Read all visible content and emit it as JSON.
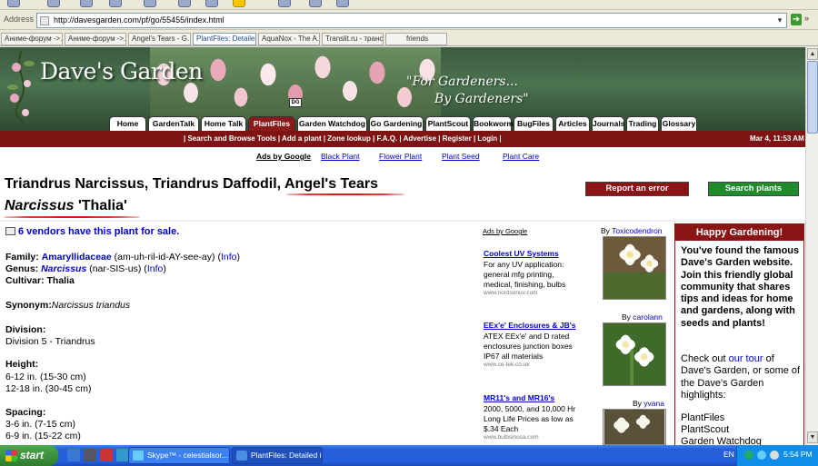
{
  "browser": {
    "address_label": "Address",
    "url": "http://davesgarden.com/pf/go/55455/index.html",
    "tabs": [
      {
        "label": "Аниме-форум ->..."
      },
      {
        "label": "Аниме-форум ->..."
      },
      {
        "label": "Angel's Tears - G..."
      },
      {
        "label": "PlantFiles: Detailed"
      },
      {
        "label": "AquaNox - The A..."
      },
      {
        "label": "Translit.ru - трансл"
      },
      {
        "label": "friends"
      }
    ]
  },
  "site": {
    "logo": "Dave's Garden",
    "slogan_line1": "\"For Gardeners...",
    "slogan_line2": "By Gardeners\"",
    "badge": "DG",
    "nav": [
      "Home",
      "GardenTalk",
      "Home Talk",
      "PlantFiles",
      "Garden Watchdog",
      "Go Gardening",
      "PlantScout",
      "Bookworm",
      "BugFiles",
      "Articles",
      "Journals",
      "Trading",
      "Glossary"
    ],
    "subnav": "| Search and Browse Tools | Add a plant | Zone lookup | F.A.Q. | Advertise | Register | Login |",
    "datetime": "Mar 4, 11:53 AM",
    "ads_by_google": "Ads by Google",
    "ad_links": [
      "Black Plant",
      "Flower Plant",
      "Plant Seed",
      "Plant Care"
    ]
  },
  "plant": {
    "title_prefix": "Triandrus Narcissus, Triandrus Daffodil, ",
    "title_highlight": "Angel's Tears",
    "latin_genus": "Narcissus",
    "cultivar_name": " 'Thalia'",
    "report_button": "Report an error",
    "search_button": "Search plants",
    "vendors": "6 vendors have this plant for sale.",
    "family_label": "Family:",
    "family": "Amaryllidaceae",
    "family_pron": " (am-uh-ril-id-AY-see-ay) (",
    "genus_label": "Genus:",
    "genus": "Narcissus",
    "genus_pron": " (nar-SIS-us) (",
    "info": "Info",
    "close_paren": ")",
    "cultivar_label": "Cultivar:",
    "cultivar": " Thalia",
    "synonym_label": "Synonym:",
    "synonym": "Narcissus triandus",
    "division_label": "Division:",
    "division": "Division 5 - Triandrus",
    "height_label": "Height:",
    "heights": [
      "6-12 in. (15-30 cm)",
      "12-18 in. (30-45 cm)"
    ],
    "spacing_label": "Spacing:",
    "spacings": [
      "3-6 in. (7-15 cm)",
      "6-9 in. (15-22 cm)"
    ]
  },
  "ads": {
    "header": "Ads by Google",
    "items": [
      {
        "title": "Coolest UV Systems",
        "lines": [
          "For any UV application:",
          "general mfg printing,",
          "medical, finishing, bulbs"
        ],
        "url": "www.nordsonuv.com"
      },
      {
        "title": "EEx'e' Enclosures & JB's",
        "lines": [
          "ATEX EEx'e' and D rated",
          "enclosures junction boxes",
          "IP67 all materials"
        ],
        "url": "www.ce-tek.co.uk"
      },
      {
        "title": "MR11's and MR16's",
        "lines": [
          "2000, 5000, and 10,000 Hr",
          "Long Life Prices as low as",
          "$.34 Each"
        ],
        "url": "www.bulbsinusa.com"
      }
    ]
  },
  "photos": [
    {
      "by": "By ",
      "user": "Toxicodendron"
    },
    {
      "by": "By ",
      "user": "carolann"
    },
    {
      "by": "By ",
      "user": "yvana"
    }
  ],
  "sidebar": {
    "header": "Happy Gardening!",
    "intro": "You've found the famous Dave's Garden website. Join this friendly global community that shares tips and ideas for home and gardens, along with seeds and plants!",
    "checkout_a": "Check out ",
    "checkout_link": "our tour",
    "checkout_b": " of Dave's Garden, or some of the Dave's Garden highlights:",
    "links": [
      "PlantFiles",
      "PlantScout",
      "Garden Watchdog"
    ]
  },
  "taskbar": {
    "start": "start",
    "windows": [
      {
        "label": "Skype™ - celestialsor..."
      },
      {
        "label": "PlantFiles: Detailed in..."
      }
    ],
    "lang": "EN",
    "clock": "5:54 PM"
  }
}
